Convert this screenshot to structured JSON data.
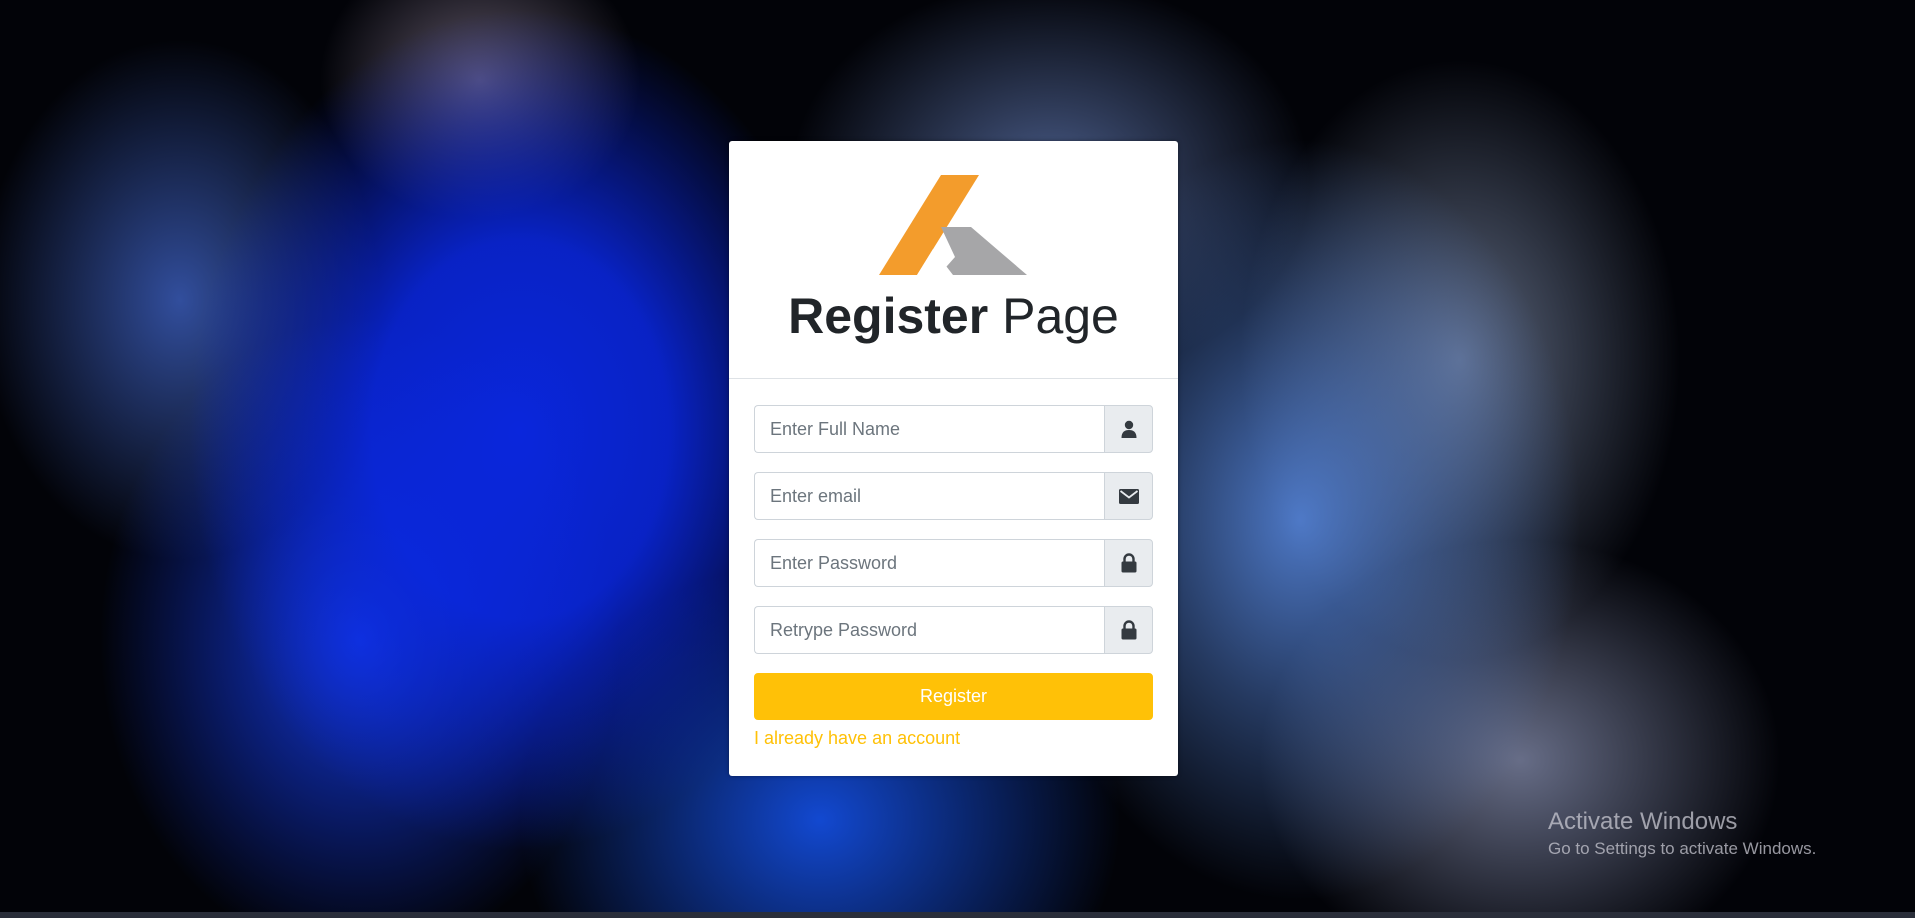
{
  "header": {
    "title_bold": "Register",
    "title_light": "Page",
    "logo": {
      "name": "logo",
      "colors": {
        "primary": "#f39c2c",
        "secondary": "#a6a6a8"
      }
    }
  },
  "form": {
    "full_name": {
      "placeholder": "Enter Full Name",
      "value": "",
      "icon": "user-icon"
    },
    "email": {
      "placeholder": "Enter email",
      "value": "",
      "icon": "envelope-icon"
    },
    "password": {
      "placeholder": "Enter Password",
      "value": "",
      "icon": "lock-icon"
    },
    "retype_password": {
      "placeholder": "Retrype Password",
      "value": "",
      "icon": "lock-icon"
    },
    "submit_label": "Register",
    "login_link": "I already have an account"
  },
  "watermark": {
    "title": "Activate Windows",
    "subtitle": "Go to Settings to activate Windows."
  },
  "colors": {
    "accent": "#ffc107",
    "addon_bg": "#e9ecef",
    "icon": "#343a40"
  }
}
